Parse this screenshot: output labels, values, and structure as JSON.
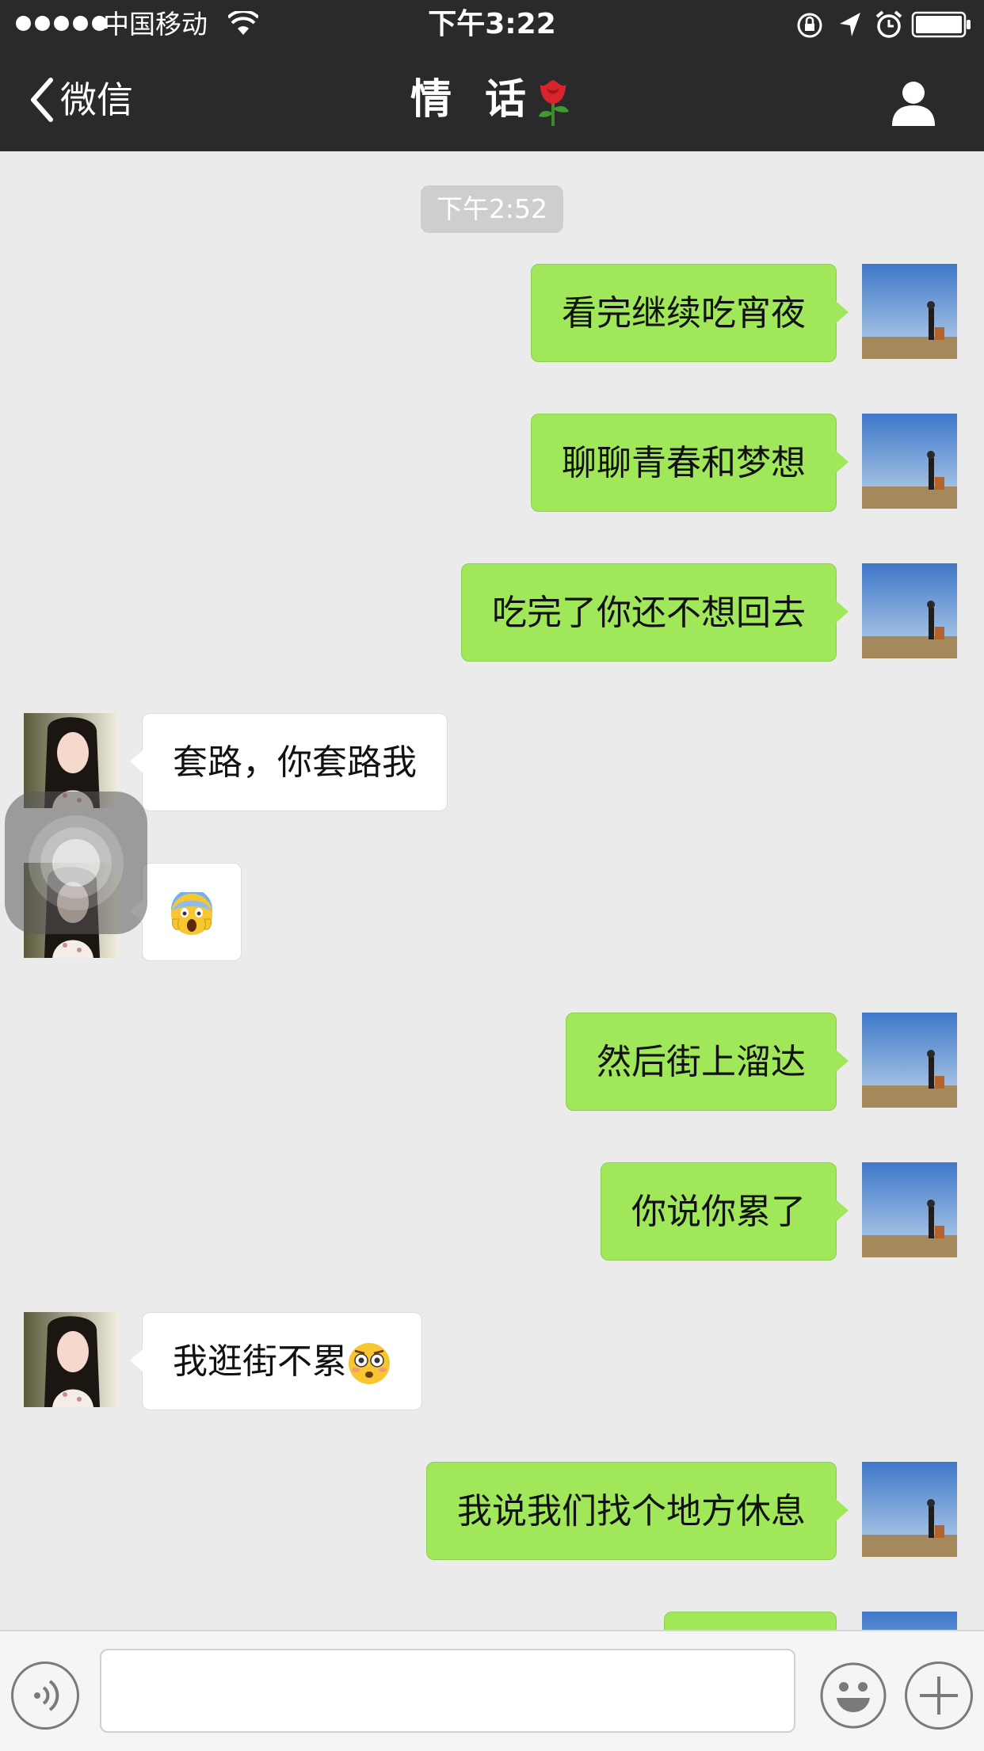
{
  "status_bar": {
    "carrier": "中国移动",
    "time": "下午3:22",
    "signal_bars": 5,
    "battery_level": 0.9
  },
  "nav": {
    "back_label": "微信",
    "title": "情 话",
    "title_emoji": "rose-icon",
    "profile_icon": "person-icon"
  },
  "chat": {
    "timestamp": "下午2:52",
    "messages": [
      {
        "from": "me",
        "text": "看完继续吃宵夜"
      },
      {
        "from": "me",
        "text": "聊聊青春和梦想"
      },
      {
        "from": "me",
        "text": "吃完了你还不想回去"
      },
      {
        "from": "her",
        "text": "套路，你套路我"
      },
      {
        "from": "her",
        "text": "",
        "emoji": "scream-emoji-icon"
      },
      {
        "from": "me",
        "text": "然后街上溜达"
      },
      {
        "from": "me",
        "text": "你说你累了"
      },
      {
        "from": "her",
        "text": "我逛街不累",
        "emoji": "flushed-emoji-icon"
      },
      {
        "from": "me",
        "text": "我说我们找个地方休息"
      }
    ]
  },
  "input_bar": {
    "message_value": "",
    "icons": [
      "voice-icon",
      "emoji-face-icon",
      "plus-icon"
    ]
  },
  "colors": {
    "nav_bg": "#2a2a2c",
    "chat_bg": "#ebebeb",
    "my_bubble": "#a0e75a",
    "her_bubble": "#ffffff"
  }
}
